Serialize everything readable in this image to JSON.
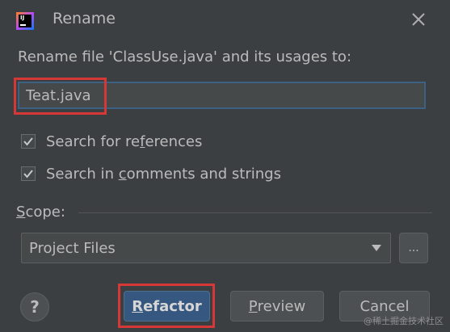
{
  "dialog": {
    "title": "Rename",
    "prompt": "Rename file 'ClassUse.java' and its usages to:",
    "new_name_value": "Teat.java",
    "options": {
      "search_references": {
        "label_before": "Search for re",
        "mnemonic": "f",
        "label_after": "erences",
        "checked": true
      },
      "search_comments": {
        "label_before": "Search in ",
        "mnemonic": "c",
        "label_after": "omments and strings",
        "checked": true
      }
    },
    "scope": {
      "label_mnemonic": "S",
      "label_rest": "cope:",
      "selected": "Project Files",
      "browse_label": "..."
    },
    "buttons": {
      "help": "?",
      "refactor_mnemonic": "R",
      "refactor_rest": "efactor",
      "preview_mnemonic": "P",
      "preview_rest": "review",
      "cancel": "Cancel"
    },
    "app_icon_text": "IJ"
  },
  "colors": {
    "background": "#3c3f41",
    "accent_primary": "#365880",
    "highlight": "#d63838",
    "focus_border": "#3d6185"
  },
  "watermark": "@稀土掘金技术社区"
}
